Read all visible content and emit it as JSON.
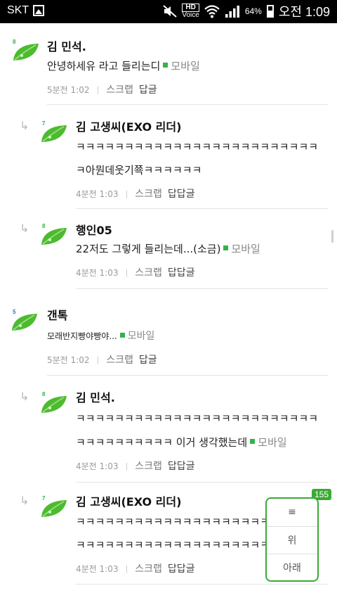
{
  "status_bar": {
    "carrier": "SKT",
    "hd_label": "HD",
    "voice_label": "Voice",
    "battery_percent": "64%",
    "time": "오전 1:09"
  },
  "comments": [
    {
      "level": "8",
      "level_color": "#35b24a",
      "author": "김 민석.",
      "lines": [
        "안녕하세유 라고 들리는디"
      ],
      "mobile": "모바일",
      "time": "5분전 1:02",
      "scrap": "스크랩",
      "reply": "답글"
    },
    {
      "level": "7",
      "level_color": "#35b24a",
      "author": "김 고생씨(EXO 리더)",
      "lines": [
        "ㅋㅋㅋㅋㅋㅋㅋㅋㅋㅋㅋㅋㅋㅋㅋㅋㅋㅋㅋㅋㅋㅋㅋㅋㅋ",
        "ㅋ아뭔데웃기쬭ㅋㅋㅋㅋㅋㅋ"
      ],
      "time": "4분전 1:03",
      "scrap": "스크랩",
      "reply": "답답글"
    },
    {
      "level": "8",
      "level_color": "#35b24a",
      "author": "행인05",
      "lines": [
        "22저도 그렇게 들리는데...(소금)"
      ],
      "mobile": "모바일",
      "time": "4분전 1:03",
      "scrap": "스크랩",
      "reply": "답답글"
    },
    {
      "level": "5",
      "level_color": "#2a6fd6",
      "author": "갠톡",
      "lines": [
        "모래반지빵야빵야..."
      ],
      "mobile": "모바일",
      "time": "5분전 1:02",
      "scrap": "스크랩",
      "reply": "답글"
    },
    {
      "level": "8",
      "level_color": "#35b24a",
      "author": "김 민석.",
      "lines": [
        "ㅋㅋㅋㅋㅋㅋㅋㅋㅋㅋㅋㅋㅋㅋㅋㅋㅋㅋㅋㅋㅋㅋㅋㅋㅋ",
        "ㅋㅋㅋㅋㅋㅋㅋㅋㅋㅋ 이거 생각했는데"
      ],
      "mobile": "모바일",
      "time": "4분전 1:03",
      "scrap": "스크랩",
      "reply": "답답글"
    },
    {
      "level": "7",
      "level_color": "#35b24a",
      "author": "김 고생씨(EXO 리더)",
      "lines": [
        "ㅋㅋㅋㅋㅋㅋㅋㅋㅋㅋㅋㅋㅋㅋㅋㅋㅋㅋㅋㅋㅋㅋㅋㅋㅋ",
        "ㅋㅋㅋㅋㅋㅋㅋㅋㅋㅋㅋㅋㅋㅋㅋㅋㅋㅋㅋㅋㅋㅋ"
      ],
      "time": "4분전 1:03",
      "scrap": "스크랩",
      "reply": "답답글"
    }
  ],
  "float_nav": {
    "count": "155",
    "menu_icon": "≡",
    "up_label": "위",
    "down_label": "아래"
  },
  "colors": {
    "accent": "#3aaa35",
    "leaf": "#4cbb2f"
  }
}
